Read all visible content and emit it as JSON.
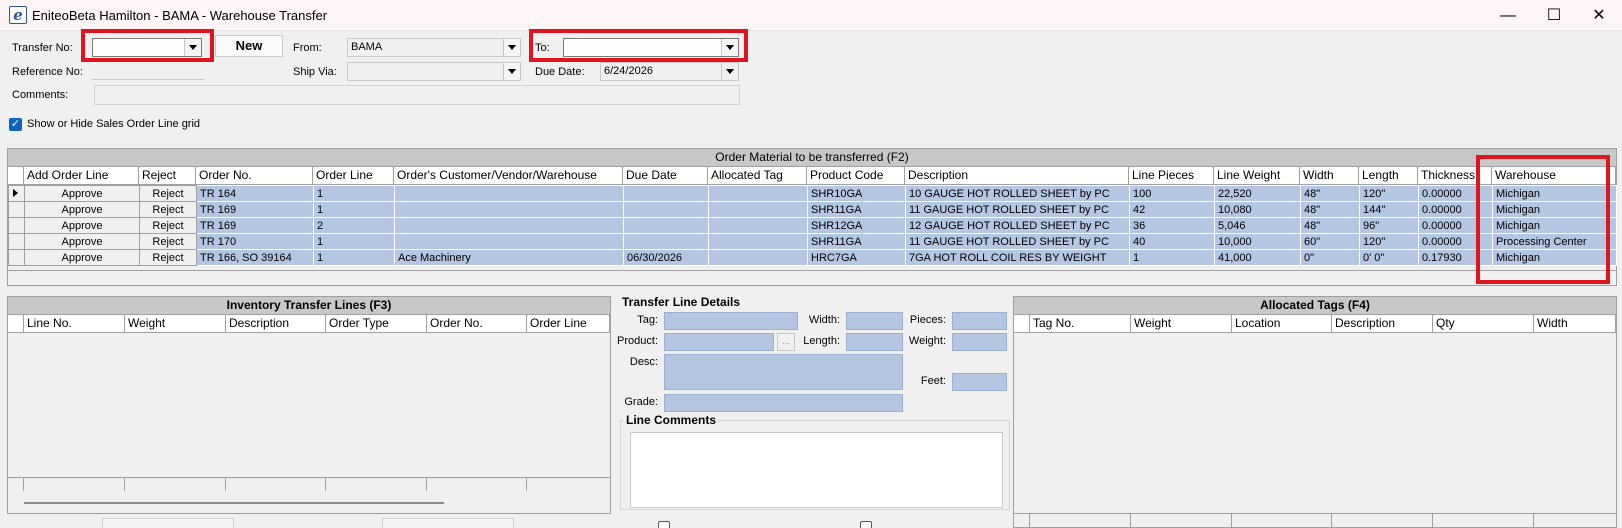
{
  "window": {
    "title": "EniteoBeta Hamilton - BAMA - Warehouse Transfer",
    "logo_letter": "e",
    "minimize": "—",
    "maximize": "☐",
    "close": "✕"
  },
  "header": {
    "transfer_no_label": "Transfer No:",
    "transfer_no_value": "",
    "new_button": "New",
    "reference_no_label": "Reference No:",
    "comments_label": "Comments:",
    "from_label": "From:",
    "from_value": "BAMA",
    "ship_via_label": "Ship Via:",
    "to_label": "To:",
    "to_value": "",
    "due_date_label": "Due Date:",
    "due_date_value": "6/24/2026"
  },
  "show_hide_checkbox": {
    "label": "Show or Hide Sales Order Line grid",
    "checked": true
  },
  "order_grid": {
    "title": "Order Material to be transferred (F2)",
    "columns": [
      "Add Order Line",
      "Reject",
      "Order No.",
      "Order Line",
      "Order's Customer/Vendor/Warehouse",
      "Due Date",
      "Allocated Tag",
      "Product Code",
      "Description",
      "Line Pieces",
      "Line Weight",
      "Width",
      "Length",
      "Thickness",
      "Warehouse"
    ],
    "rows": [
      {
        "add": "Approve",
        "reject": "Reject",
        "order_no": "TR 164",
        "order_line": "1",
        "customer": "",
        "due_date": "",
        "allocated_tag": "",
        "product_code": "SHR10GA",
        "description": "10 GAUGE HOT ROLLED SHEET by PC",
        "line_pieces": "100",
        "line_weight": "22,520",
        "width": "48\"",
        "length": "120\"",
        "thickness": "0.00000",
        "warehouse": "Michigan"
      },
      {
        "add": "Approve",
        "reject": "Reject",
        "order_no": "TR 169",
        "order_line": "1",
        "customer": "",
        "due_date": "",
        "allocated_tag": "",
        "product_code": "SHR11GA",
        "description": "11 GAUGE HOT ROLLED SHEET by PC",
        "line_pieces": "42",
        "line_weight": "10,080",
        "width": "48\"",
        "length": "144\"",
        "thickness": "0.00000",
        "warehouse": "Michigan"
      },
      {
        "add": "Approve",
        "reject": "Reject",
        "order_no": "TR 169",
        "order_line": "2",
        "customer": "",
        "due_date": "",
        "allocated_tag": "",
        "product_code": "SHR12GA",
        "description": "12 GAUGE HOT ROLLED SHEET by PC",
        "line_pieces": "36",
        "line_weight": "5,046",
        "width": "48\"",
        "length": "96\"",
        "thickness": "0.00000",
        "warehouse": "Michigan"
      },
      {
        "add": "Approve",
        "reject": "Reject",
        "order_no": "TR 170",
        "order_line": "1",
        "customer": "",
        "due_date": "",
        "allocated_tag": "",
        "product_code": "SHR11GA",
        "description": "11 GAUGE HOT ROLLED SHEET by PC",
        "line_pieces": "40",
        "line_weight": "10,000",
        "width": "60\"",
        "length": "120\"",
        "thickness": "0.00000",
        "warehouse": "Processing Center"
      },
      {
        "add": "Approve",
        "reject": "Reject",
        "order_no": "TR 166, SO 39164",
        "order_line": "1",
        "customer": "Ace Machinery",
        "due_date": "06/30/2026",
        "allocated_tag": "",
        "product_code": "HRC7GA",
        "description": "7GA HOT ROLL COIL RES BY WEIGHT",
        "line_pieces": "1",
        "line_weight": "41,000",
        "width": "0\"",
        "length": "0' 0\"",
        "thickness": "0.17930",
        "warehouse": "Michigan"
      }
    ]
  },
  "inventory_lines": {
    "title": "Inventory Transfer Lines (F3)",
    "columns": [
      "Line No.",
      "Weight",
      "Description",
      "Order Type",
      "Order No.",
      "Order Line"
    ]
  },
  "transfer_line_details": {
    "title": "Transfer Line Details",
    "tag_label": "Tag:",
    "product_label": "Product:",
    "product_browse": "...",
    "desc_label": "Desc:",
    "grade_label": "Grade:",
    "width_label": "Width:",
    "length_label": "Length:",
    "pieces_label": "Pieces:",
    "weight_label": "Weight:",
    "feet_label": "Feet:",
    "line_comments_title": "Line Comments"
  },
  "allocated_tags": {
    "title": "Allocated Tags (F4)",
    "columns": [
      "Tag No.",
      "Weight",
      "Location",
      "Description",
      "Qty",
      "Width"
    ]
  }
}
